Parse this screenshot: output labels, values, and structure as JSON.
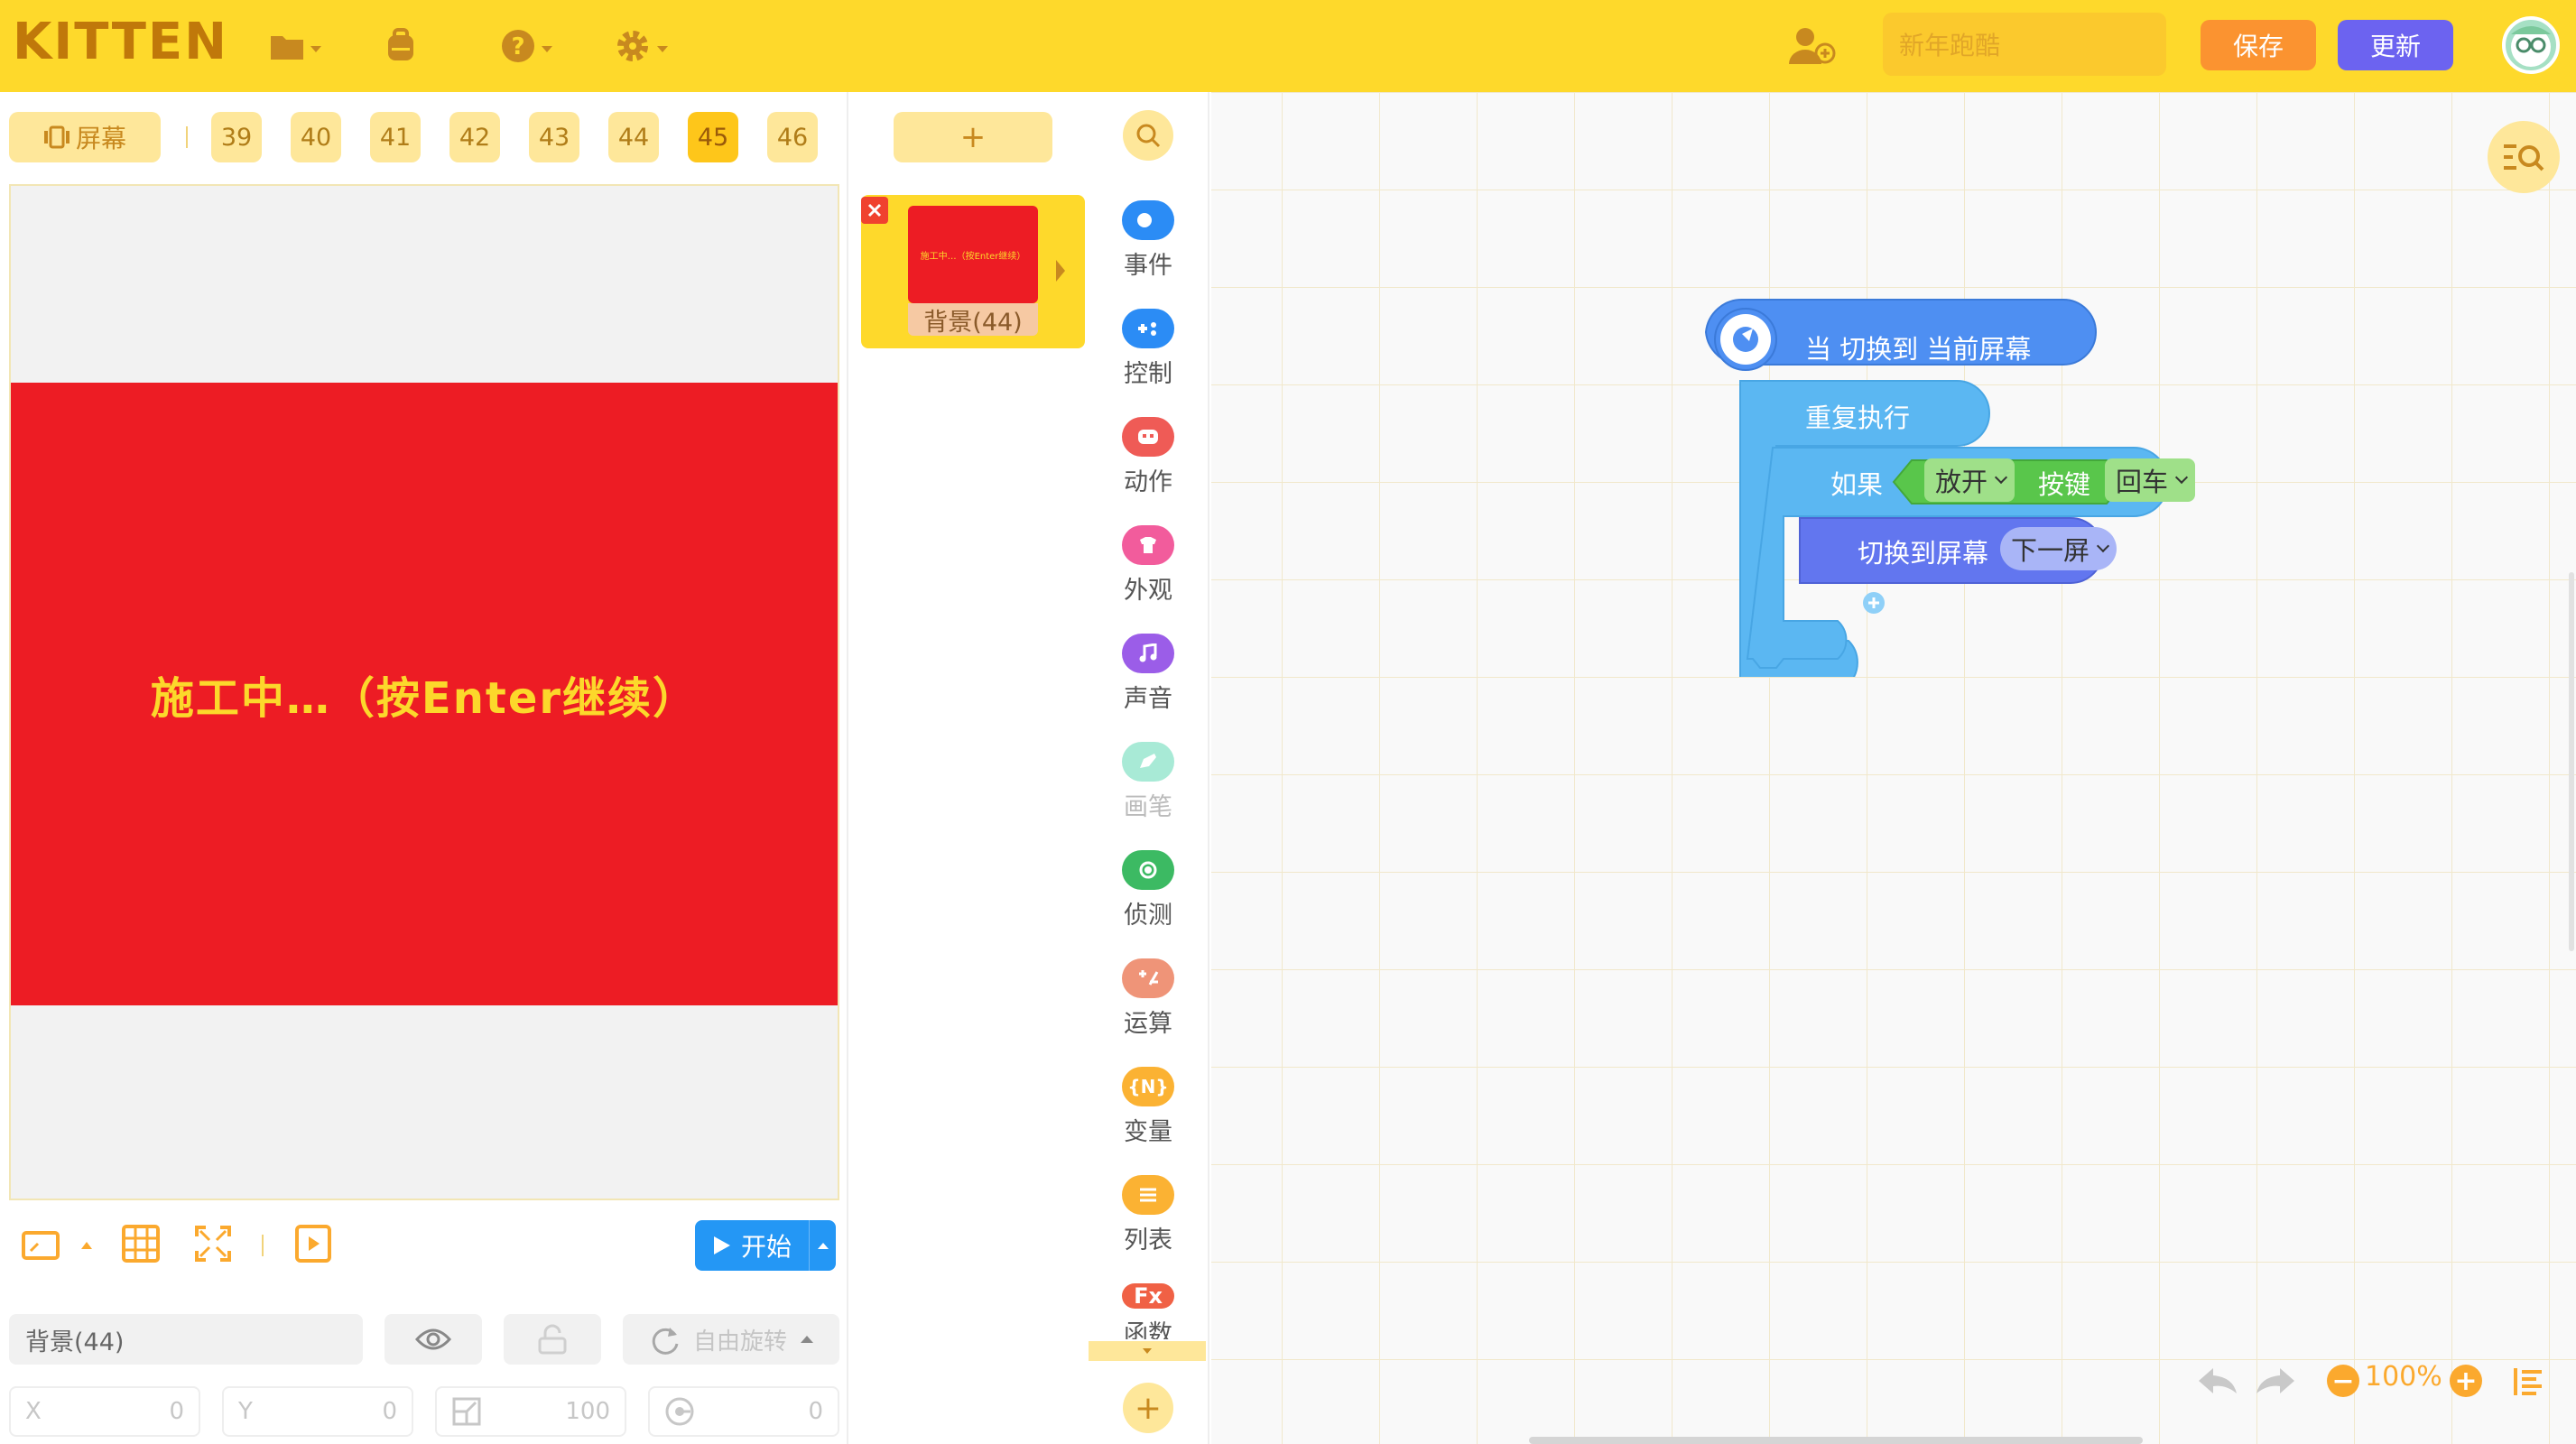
{
  "app": {
    "logo": "KITTEN",
    "project_name_placeholder": "新年跑酷",
    "save_label": "保存",
    "update_label": "更新"
  },
  "scenes": {
    "screen_label": "屏幕",
    "items": [
      "39",
      "40",
      "41",
      "42",
      "43",
      "44",
      "45",
      "46"
    ],
    "active": "45"
  },
  "stage": {
    "text": "施工中…（按Enter继续）",
    "start_label": "开始",
    "background_color": "#ed1c24",
    "text_color": "#fcd82b"
  },
  "properties": {
    "sprite_name": "背景(44)",
    "rotation_label": "自由旋转",
    "x_label": "X",
    "x_value": "0",
    "y_label": "Y",
    "y_value": "0",
    "size_value": "100",
    "direction_value": "0"
  },
  "sprite_list": {
    "add_label": "+",
    "sprites": [
      {
        "name": "背景(44)",
        "thumb_text": "施工中…（按Enter继续）"
      }
    ]
  },
  "categories": [
    {
      "label": "事件",
      "color": "#2b8cf5",
      "icon": "event-icon"
    },
    {
      "label": "控制",
      "color": "#2b8cf5",
      "icon": "control-icon"
    },
    {
      "label": "动作",
      "color": "#ef5b56",
      "icon": "motion-icon"
    },
    {
      "label": "外观",
      "color": "#f25c9c",
      "icon": "looks-icon"
    },
    {
      "label": "声音",
      "color": "#9b5de8",
      "icon": "sound-icon"
    },
    {
      "label": "画笔",
      "color": "#a8ead6",
      "icon": "pen-icon"
    },
    {
      "label": "侦测",
      "color": "#3cba63",
      "icon": "sensing-icon"
    },
    {
      "label": "运算",
      "color": "#ef9478",
      "icon": "operator-icon"
    },
    {
      "label": "变量",
      "color": "#fbb233",
      "icon": "variable-icon"
    },
    {
      "label": "列表",
      "color": "#fbb233",
      "icon": "list-icon"
    },
    {
      "label": "函数",
      "color": "#f06145",
      "icon": "function-icon"
    }
  ],
  "function_glyph": "Fx",
  "variable_glyph": "{N}",
  "blocks": {
    "hat": "当 切换到 当前屏幕",
    "repeat": "重复执行",
    "if": "如果",
    "key_state": "放开",
    "key_label": "按键",
    "key_value": "回车",
    "switch_screen": "切换到屏幕",
    "switch_target": "下一屏"
  },
  "workspace": {
    "zoom": "100%"
  },
  "colors": {
    "topbar": "#fed92b",
    "save": "#fb9330",
    "update": "#6c63f0",
    "control_block": "#5bb7f2",
    "hat_block": "#4e8ff2",
    "sensing_block": "#59c64b",
    "screen_block": "#6276ef"
  }
}
